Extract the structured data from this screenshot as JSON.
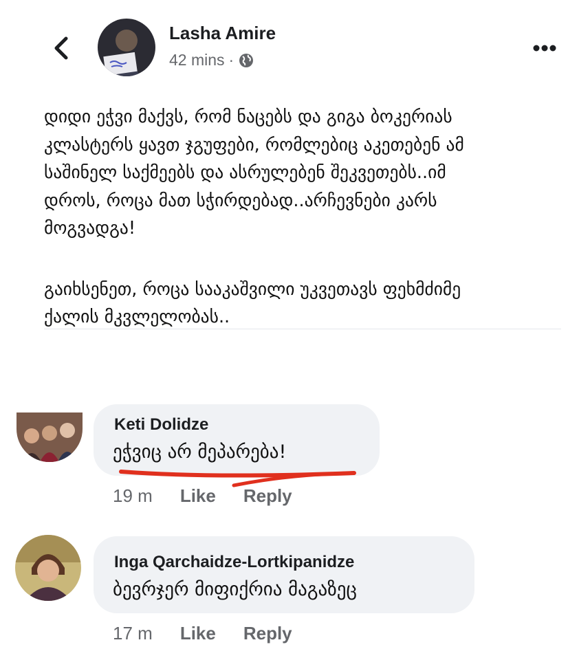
{
  "post": {
    "author": "Lasha Amire",
    "time": "42 mins",
    "separator": "·",
    "paragraph1_lines": [
      "დიდი ეჭვი მაქვს, რომ ნაცებს და გიგა ბოკერიას",
      "კლასტერს ყავთ ჯგუფები, რომლებიც აკეთებენ ამ",
      "საშინელ საქმეებს და ასრულებენ შეკვეთებს..იმ",
      "დროს, როცა მათ სჭირდებად..არჩევნები კარს",
      "მოგვადგა!"
    ],
    "paragraph2_lines": [
      "გაიხსენეთ, როცა სააკაშვილი უკვეთავს ფეხმძიმე",
      "ქალის მკვლელობას.."
    ]
  },
  "comments": [
    {
      "name": "Keti Dolidze",
      "text": "ეჭვიც არ მეპარება!",
      "time": "19 m",
      "like": "Like",
      "reply": "Reply",
      "annotation_color": "#e0301e"
    },
    {
      "name": "Inga Qarchaidze-Lortkipanidze",
      "text": "ბევრჯერ მიფიქრია მაგაზეც",
      "time": "17 m",
      "like": "Like",
      "reply": "Reply"
    }
  ],
  "icons": {
    "back": "chevron-left-icon",
    "audience": "globe-icon",
    "more": "more-horizontal-icon"
  }
}
